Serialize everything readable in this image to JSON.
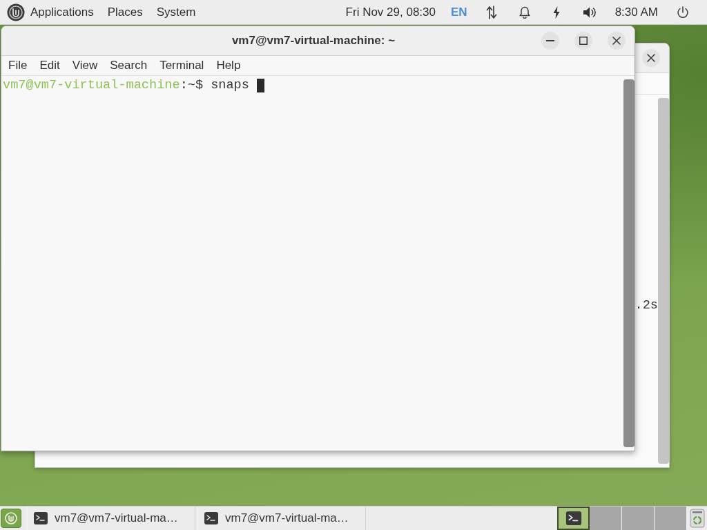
{
  "top_panel": {
    "menus": [
      "Applications",
      "Places",
      "System"
    ],
    "date": "Fri Nov 29, 08:30",
    "keyboard_layout": "EN",
    "clock": "8:30 AM"
  },
  "background_window": {
    "output_fragment": ".2s"
  },
  "terminal_window": {
    "title": "vm7@vm7-virtual-machine: ~",
    "menu": [
      "File",
      "Edit",
      "View",
      "Search",
      "Terminal",
      "Help"
    ],
    "lines": [
      {
        "user_host": "vm7@vm7-virtual-machine",
        "prompt": ":~$",
        "command": "snaps",
        "cursor": true
      }
    ]
  },
  "bottom_panel": {
    "tasks": [
      {
        "label": "vm7@vm7-virtual-ma…"
      },
      {
        "label": "vm7@vm7-virtual-ma…"
      }
    ],
    "workspaces": [
      {
        "selected": true,
        "has_window": true
      },
      {
        "selected": false,
        "has_window": false
      },
      {
        "selected": false,
        "has_window": false
      },
      {
        "selected": false,
        "has_window": false
      }
    ]
  }
}
